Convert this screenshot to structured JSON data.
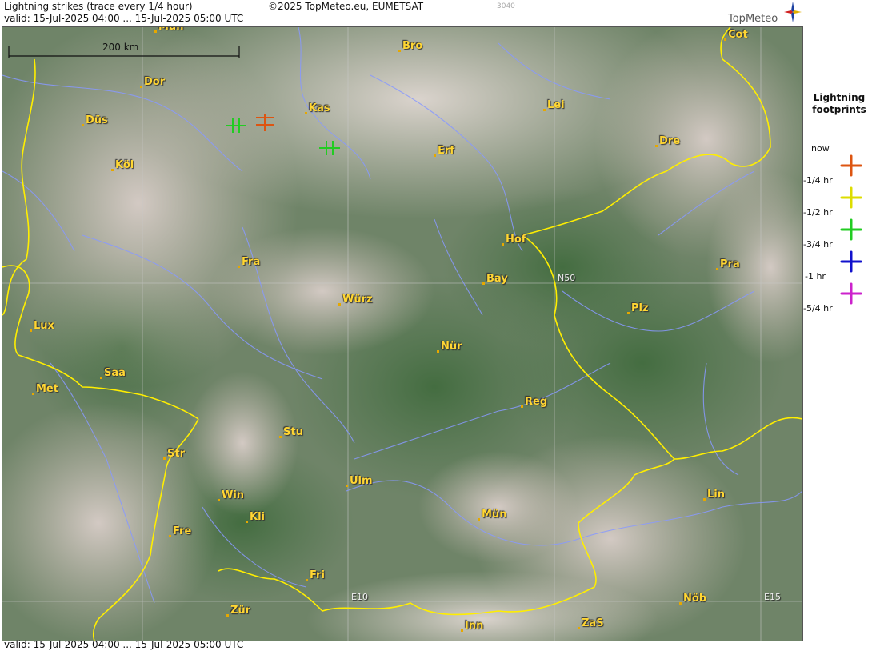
{
  "header": {
    "title": "Lightning strikes (trace every 1/4 hour)",
    "valid": "valid:  15-Jul-2025 04:00 ... 15-Jul-2025 05:00 UTC",
    "copyright": "©2025 TopMeteo.eu, EUMETSAT",
    "code": "3040",
    "brand": "TopMeteo"
  },
  "footer": {
    "valid": "valid:  15-Jul-2025 04:00 ... 15-Jul-2025 05:00 UTC"
  },
  "map": {
    "scale_label": "200 km",
    "grid_labels": {
      "n50": "N50",
      "e10": "E10",
      "e15": "E15"
    },
    "cities": [
      {
        "name": "Mün"
      },
      {
        "name": "Bro"
      },
      {
        "name": "Cot"
      },
      {
        "name": "Dor"
      },
      {
        "name": "Kas"
      },
      {
        "name": "Lei"
      },
      {
        "name": "Düs"
      },
      {
        "name": "Erf"
      },
      {
        "name": "Dre"
      },
      {
        "name": "Köl"
      },
      {
        "name": "Hof"
      },
      {
        "name": "Fra"
      },
      {
        "name": "Bay"
      },
      {
        "name": "Pra"
      },
      {
        "name": "Würz"
      },
      {
        "name": "Plz"
      },
      {
        "name": "Lux"
      },
      {
        "name": "Nür"
      },
      {
        "name": "Saa"
      },
      {
        "name": "Met"
      },
      {
        "name": "Reg"
      },
      {
        "name": "Stu"
      },
      {
        "name": "Str"
      },
      {
        "name": "Ulm"
      },
      {
        "name": "Lin"
      },
      {
        "name": "Win"
      },
      {
        "name": "Kli"
      },
      {
        "name": "Mün"
      },
      {
        "name": "Fre"
      },
      {
        "name": "Fri"
      },
      {
        "name": "Nöb"
      },
      {
        "name": "Zür"
      },
      {
        "name": "Inn"
      },
      {
        "name": "ZaS"
      }
    ],
    "strikes": [
      {
        "color": "#22cc22",
        "age": "-3/4 hr"
      },
      {
        "color": "#22cc22",
        "age": "-3/4 hr"
      },
      {
        "color": "#dd5511",
        "age": "-1/4 hr"
      },
      {
        "color": "#22cc22",
        "age": "-3/4 hr"
      },
      {
        "color": "#22cc22",
        "age": "-3/4 hr"
      }
    ],
    "colors": {
      "border": "#ffee00",
      "rivers": "#8899ff",
      "grid": "#cccccc"
    }
  },
  "legend": {
    "title_line1": "Lightning",
    "title_line2": "footprints",
    "ticks": [
      "now",
      "-1/4 hr",
      "-1/2 hr",
      "-3/4 hr",
      "-1 hr",
      "-5/4 hr"
    ],
    "symbols": [
      {
        "color": "#dd5511"
      },
      {
        "color": "#dddd00"
      },
      {
        "color": "#22cc22"
      },
      {
        "color": "#1111cc"
      },
      {
        "color": "#cc22cc"
      }
    ]
  }
}
